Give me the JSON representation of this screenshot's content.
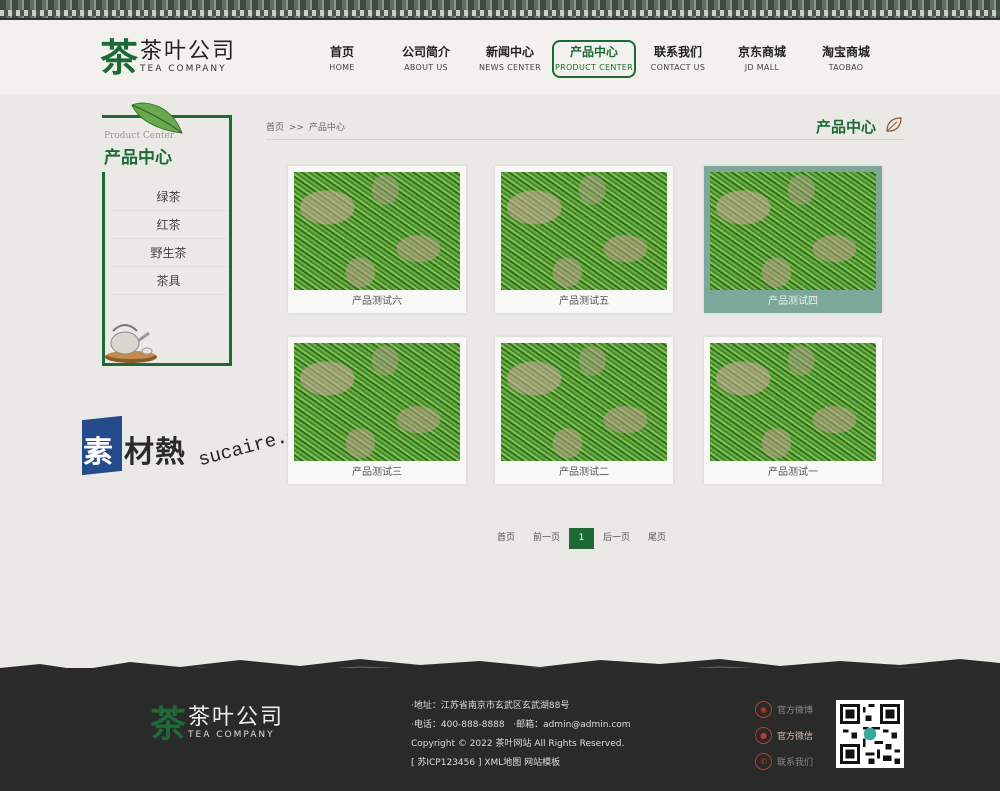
{
  "site": {
    "logo_mark": "茶",
    "logo_cn": "茶叶公司",
    "logo_en": "TEA COMPANY"
  },
  "nav": [
    {
      "cn": "首页",
      "en": "HOME"
    },
    {
      "cn": "公司简介",
      "en": "ABOUT US"
    },
    {
      "cn": "新闻中心",
      "en": "NEWS CENTER"
    },
    {
      "cn": "产品中心",
      "en": "PRODUCT CENTER",
      "active": true
    },
    {
      "cn": "联系我们",
      "en": "CONTACT US"
    },
    {
      "cn": "京东商城",
      "en": "JD MALL"
    },
    {
      "cn": "淘宝商城",
      "en": "TAOBAO"
    }
  ],
  "sidebar": {
    "title_en": "Product Center",
    "title_cn": "产品中心",
    "items": [
      "绿茶",
      "红茶",
      "野生茶",
      "茶具"
    ]
  },
  "watermark": {
    "su": "素",
    "cai": "材熱",
    "url": "sucaire.com"
  },
  "breadcrumb": {
    "home": "首页",
    "sep": ">>",
    "current": "产品中心"
  },
  "main_title": "产品中心",
  "products": [
    {
      "name": "产品测试六"
    },
    {
      "name": "产品测试五"
    },
    {
      "name": "产品测试四",
      "active": true
    },
    {
      "name": "产品测试三"
    },
    {
      "name": "产品测试二"
    },
    {
      "name": "产品测试一"
    }
  ],
  "pagination": {
    "first": "首页",
    "prev": "前一页",
    "current": "1",
    "next": "后一页",
    "last": "尾页"
  },
  "footer": {
    "address": "·地址：江苏省南京市玄武区玄武湖88号",
    "phone": "·电话：400-888-8888",
    "email": "·邮箱：admin@admin.com",
    "copyright": "Copyright © 2022 茶叶网站 All Rights Reserved.",
    "icp": "[ 苏ICP123456 ] XML地图 网站模板",
    "links": [
      {
        "label": "官方微博",
        "icon": "weibo-icon"
      },
      {
        "label": "官方微信",
        "icon": "wechat-icon",
        "highlight": true
      },
      {
        "label": "联系我们",
        "icon": "phone-icon"
      }
    ]
  },
  "colors": {
    "brand_green": "#1d6a37",
    "footer_bg": "#2a2a2a",
    "active_card": "#7ba89a"
  }
}
